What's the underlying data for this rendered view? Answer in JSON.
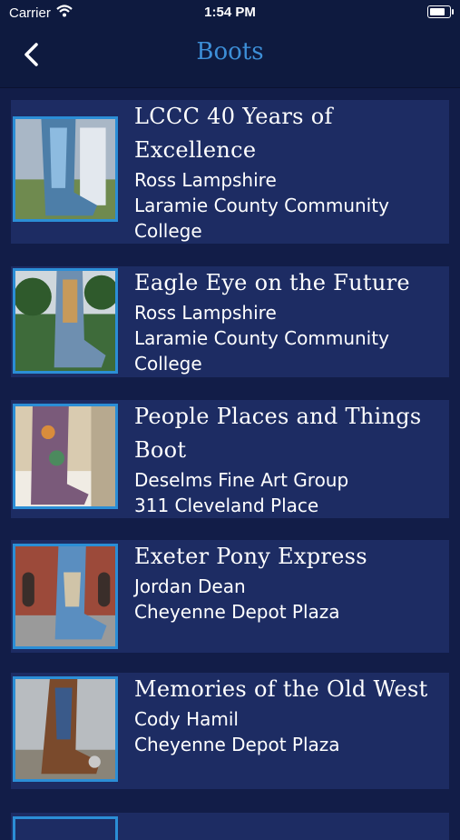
{
  "status_bar": {
    "carrier": "Carrier",
    "time": "1:54 PM",
    "battery_level": 0.9
  },
  "nav": {
    "title": "Boots",
    "back_icon": "chevron-left-icon"
  },
  "colors": {
    "background": "#121d48",
    "card": "#1d2c63",
    "accent": "#3d8fd8",
    "thumb_border": "#2b8ed6"
  },
  "boots": [
    {
      "title": "LCCC 40 Years of Excellence",
      "artist": "Ross Lampshire",
      "location": "Laramie County Community College"
    },
    {
      "title": "Eagle Eye on the Future",
      "artist": "Ross Lampshire",
      "location": "Laramie County Community College"
    },
    {
      "title": "People Places and Things Boot",
      "artist": " Deselms Fine Art Group",
      "location": "311 Cleveland Place"
    },
    {
      "title": "Exeter Pony Express",
      "artist": "Jordan Dean",
      "location": "Cheyenne Depot Plaza"
    },
    {
      "title": "Memories of the Old West",
      "artist": "Cody Hamil",
      "location": "Cheyenne Depot Plaza"
    }
  ]
}
